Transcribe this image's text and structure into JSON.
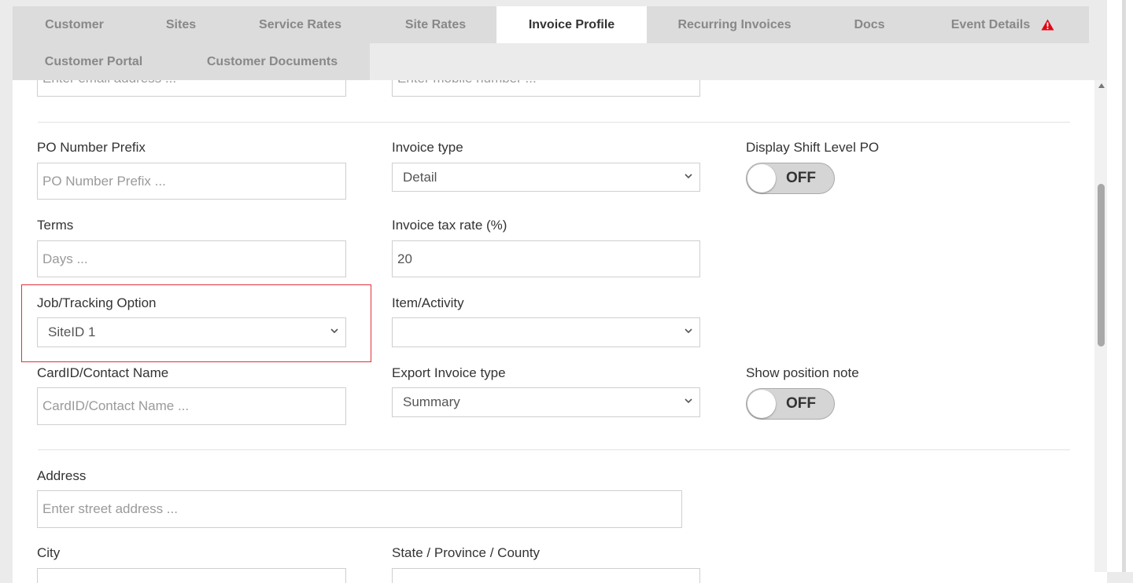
{
  "tabs": [
    {
      "label": "Customer"
    },
    {
      "label": "Sites"
    },
    {
      "label": "Service Rates"
    },
    {
      "label": "Site Rates"
    },
    {
      "label": "Invoice Profile"
    },
    {
      "label": "Recurring Invoices"
    },
    {
      "label": "Docs"
    },
    {
      "label": "Event Details"
    },
    {
      "label": "Customer Portal"
    },
    {
      "label": "Customer Documents"
    }
  ],
  "active_tab": "Invoice Profile",
  "warning_icon": "warning-triangle-icon",
  "colors": {
    "warning": "#e30613",
    "highlight": "#e0313a",
    "active_tab": "#ffffff",
    "tab_bg": "#dcdcdc"
  },
  "form": {
    "email": {
      "placeholder": "Enter email address ..."
    },
    "mobile": {
      "placeholder": "Enter mobile number ..."
    },
    "po_prefix": {
      "label": "PO Number Prefix",
      "placeholder": "PO Number Prefix ..."
    },
    "invoice_type": {
      "label": "Invoice type",
      "value": "Detail"
    },
    "shift_po": {
      "label": "Display Shift Level PO",
      "state": "OFF"
    },
    "terms": {
      "label": "Terms",
      "placeholder": "Days ..."
    },
    "tax_rate": {
      "label": "Invoice tax rate (%)",
      "value": "20"
    },
    "job_tracking": {
      "label": "Job/Tracking Option",
      "value": "SiteID 1"
    },
    "item_activity": {
      "label": "Item/Activity",
      "value": ""
    },
    "card_id": {
      "label": "CardID/Contact Name",
      "placeholder": "CardID/Contact Name ..."
    },
    "export_type": {
      "label": "Export Invoice type",
      "value": "Summary"
    },
    "position_note": {
      "label": "Show position note",
      "state": "OFF"
    },
    "address": {
      "label": "Address",
      "placeholder": "Enter street address ..."
    },
    "city": {
      "label": "City"
    },
    "state": {
      "label": "State / Province / County"
    }
  }
}
